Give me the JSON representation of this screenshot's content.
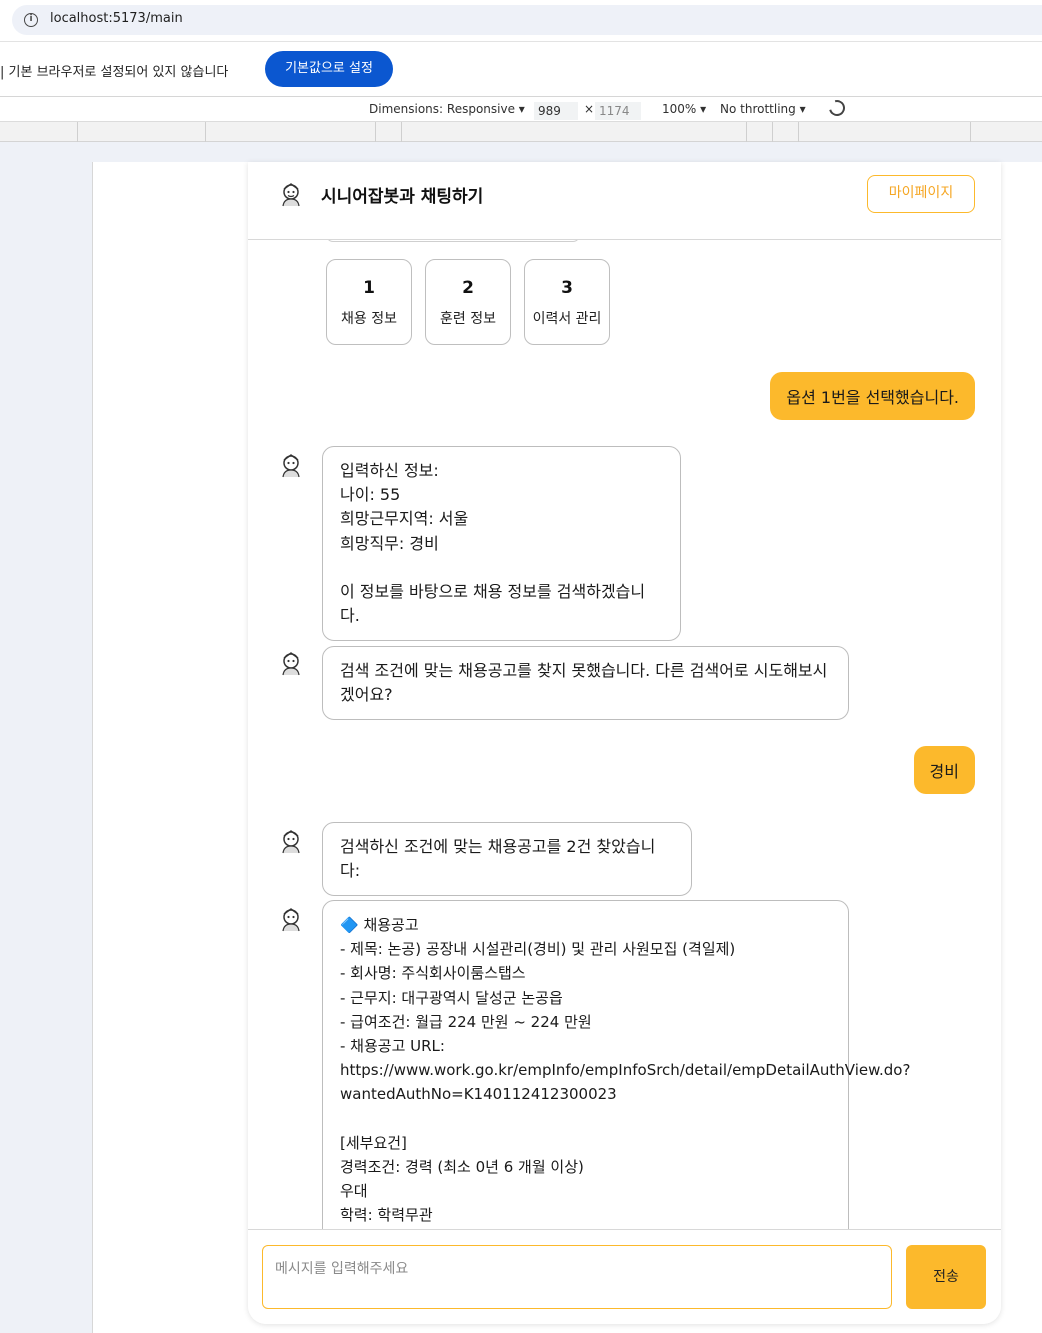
{
  "browser": {
    "url": "localhost:5173/main",
    "infobar_text": "| 기본 브라우저로 설정되어 있지 않습니다",
    "infobar_button": "기본값으로 설정"
  },
  "devtools": {
    "dimensions_label": "Dimensions: Responsive ▾",
    "width": "989",
    "times": "×",
    "height": "1174",
    "zoom": "100% ▾",
    "throttling": "No throttling ▾"
  },
  "chat": {
    "title": "시니어잡봇과 채팅하기",
    "mypage_button": "마이페이지",
    "options": [
      {
        "num": "1",
        "label": "채용 정보"
      },
      {
        "num": "2",
        "label": "훈련 정보"
      },
      {
        "num": "3",
        "label": "이력서 관리"
      }
    ],
    "messages": [
      {
        "role": "user",
        "text": "옵션 1번을 선택했습니다."
      },
      {
        "role": "bot",
        "text": "입력하신 정보:\n나이: 55\n희망근무지역: 서울\n희망직무: 경비\n\n이 정보를 바탕으로 채용 정보를 검색하겠습니다."
      },
      {
        "role": "bot",
        "text": "검색 조건에 맞는 채용공고를 찾지 못했습니다. 다른 검색어로 시도해보시\n겠어요?"
      },
      {
        "role": "user",
        "text": "경비"
      },
      {
        "role": "bot",
        "text": "검색하신 조건에 맞는 채용공고를 2건 찾았습니다:"
      },
      {
        "role": "bot",
        "text": "🔷 채용공고\n- 제목: 논공) 공장내 시설관리(경비) 및 관리 사원모집 (격일제)\n- 회사명: 주식회사이룸스탭스\n- 근무지: 대구광역시 달성군 논공읍\n- 급여조건: 월급 224 만원 ~ 224 만원\n- 채용공고 URL:\nhttps://www.work.go.kr/empInfo/empInfoSrch/detail/empDetailAuthView.do?\nwantedAuthNo=K140112412300023\n\n[세부요건]\n경력조건: 경력 (최소 0년 6 개월 이상)\n우대\n학력: 학력무관"
      }
    ],
    "input_placeholder": "메시지를 입력해주세요",
    "send_button": "전송"
  },
  "colors": {
    "accent": "#fcb92c",
    "chrome_blue": "#0b57d0"
  }
}
